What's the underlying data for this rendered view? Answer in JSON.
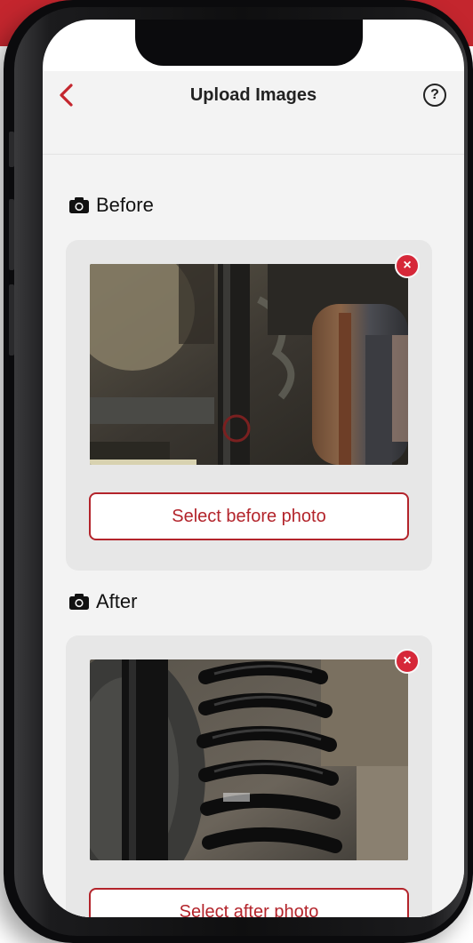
{
  "nav": {
    "back_icon": "chevron-left-icon",
    "title": "Upload Images",
    "help_icon": "help-circle-icon",
    "help_glyph": "?"
  },
  "sections": [
    {
      "id": "before",
      "icon": "camera-icon",
      "label": "Before",
      "photo": "suspension-before-photo",
      "remove_glyph": "×",
      "button_label": "Select before photo"
    },
    {
      "id": "after",
      "icon": "camera-icon",
      "label": "After",
      "photo": "suspension-after-photo",
      "remove_glyph": "×",
      "button_label": "Select after photo"
    }
  ],
  "colors": {
    "accent": "#c4262e",
    "remove_badge": "#d62839",
    "background": "#f3f3f3",
    "card": "#e7e7e7"
  }
}
